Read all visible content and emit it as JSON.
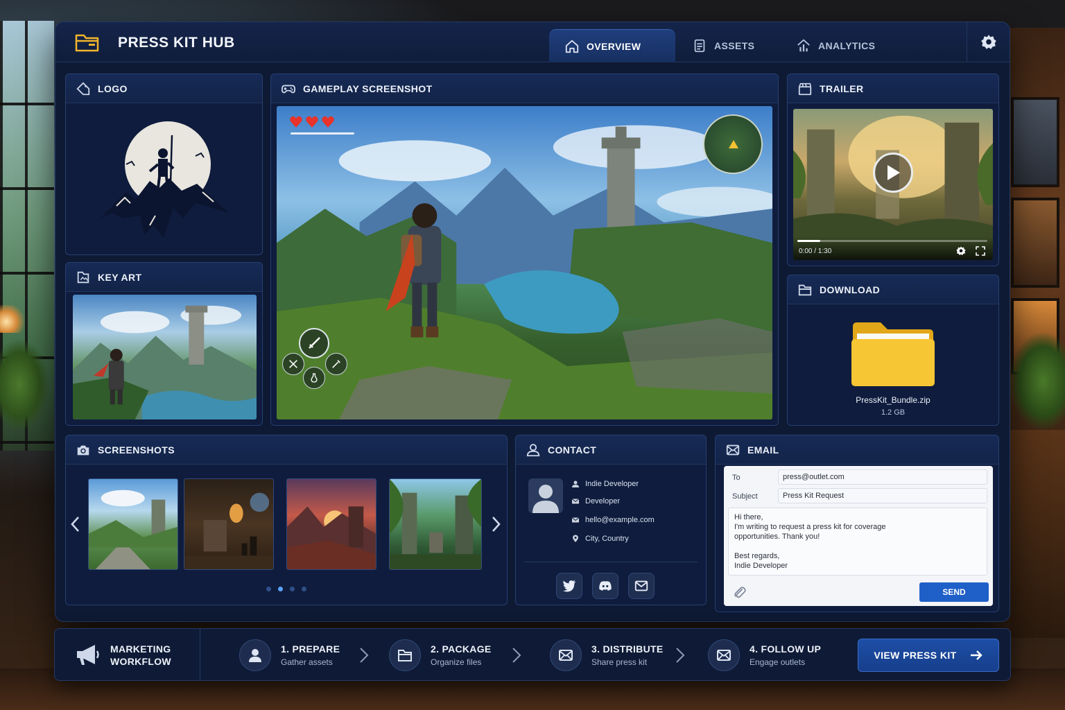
{
  "app": {
    "title": "PRESS KIT HUB"
  },
  "nav": {
    "tabs": [
      {
        "label": "OVERVIEW",
        "icon": "home-icon",
        "active": true
      },
      {
        "label": "ASSETS",
        "icon": "document-icon",
        "active": false
      },
      {
        "label": "ANALYTICS",
        "icon": "analytics-icon",
        "active": false
      }
    ],
    "settings_icon": "gear-icon"
  },
  "panels": {
    "logo": {
      "title": "LOGO"
    },
    "key_art": {
      "title": "KEY ART"
    },
    "gameplay": {
      "title": "GAMEPLAY SCREENSHOT",
      "hearts": 3
    },
    "trailer": {
      "title": "TRAILER",
      "time": "0:00 / 1:30",
      "progress": 0.12
    },
    "download": {
      "title": "DOWNLOAD",
      "file_name": "PressKit_Bundle.zip",
      "file_size": "1.2 GB"
    },
    "screenshots": {
      "title": "SCREENSHOTS",
      "count": 4,
      "pages": 4,
      "active_page": 1
    },
    "contact": {
      "title": "CONTACT",
      "rows": [
        {
          "icon": "person-icon",
          "text": "Indie Developer"
        },
        {
          "icon": "mail-icon",
          "text": "Developer"
        },
        {
          "icon": "mail-icon",
          "text": "hello@example.com"
        },
        {
          "icon": "location-icon",
          "text": "City, Country"
        }
      ],
      "socials": [
        "twitter-icon",
        "discord-icon",
        "mail-icon"
      ]
    },
    "email": {
      "title": "EMAIL",
      "to_label": "To",
      "to_value": "press@outlet.com",
      "subject_label": "Subject",
      "subject_value": "Press Kit Request",
      "body": "Hi there,\nI'm writing to request a press kit for coverage\nopportunities. Thank you!\n\nBest regards,\nIndie Developer",
      "send_label": "SEND"
    }
  },
  "workflow": {
    "title_line1": "MARKETING",
    "title_line2": "WORKFLOW",
    "steps": [
      {
        "title": "1. PREPARE",
        "subtitle": "Gather assets",
        "icon": "person-icon"
      },
      {
        "title": "2. PACKAGE",
        "subtitle": "Organize files",
        "icon": "folder-icon"
      },
      {
        "title": "3. DISTRIBUTE",
        "subtitle": "Share press kit",
        "icon": "mail-icon"
      },
      {
        "title": "4. FOLLOW UP",
        "subtitle": "Engage outlets",
        "icon": "mail-icon"
      }
    ],
    "cta_label": "VIEW PRESS KIT"
  },
  "colors": {
    "accent": "#1f5fc8",
    "panel": "#13224a",
    "background": "#0e1a33",
    "folder": "#f5c030"
  }
}
